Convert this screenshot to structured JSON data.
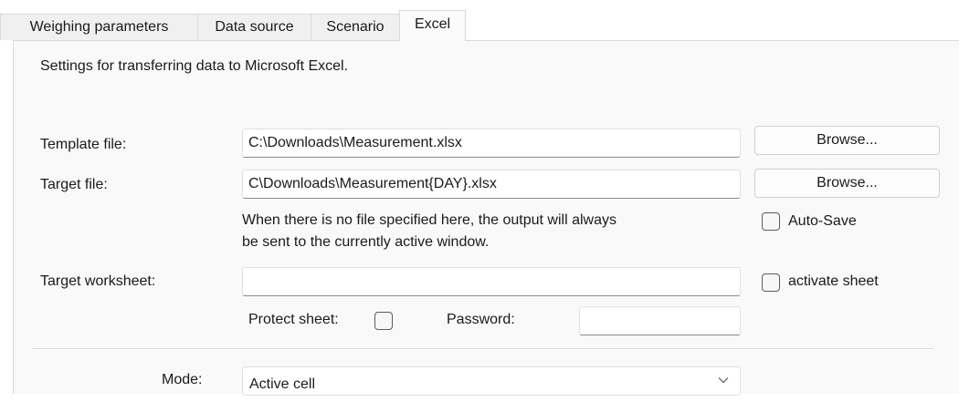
{
  "tabs": [
    {
      "label": "Weighing parameters",
      "active": false
    },
    {
      "label": "Data source",
      "active": false
    },
    {
      "label": "Scenario",
      "active": false
    },
    {
      "label": "Excel",
      "active": true
    }
  ],
  "excel": {
    "description": "Settings for transferring data to Microsoft Excel.",
    "template_file": {
      "label": "Template file:",
      "value": "C:\\Downloads\\Measurement.xlsx",
      "browse_label": "Browse..."
    },
    "target_file": {
      "label": "Target file:",
      "value": "C\\Downloads\\Measurement{DAY}.xlsx",
      "browse_label": "Browse..."
    },
    "hint_line1": "When there is no file specified here, the output will always",
    "hint_line2": "be sent to the currently active window.",
    "auto_save": {
      "label": "Auto-Save",
      "checked": false
    },
    "target_worksheet": {
      "label": "Target worksheet:",
      "value": ""
    },
    "activate_sheet": {
      "label": "activate sheet",
      "checked": false
    },
    "protect_sheet": {
      "label": "Protect sheet:",
      "checked": false
    },
    "password": {
      "label": "Password:",
      "value": ""
    },
    "mode": {
      "label": "Mode:",
      "selected": "Active cell"
    }
  }
}
